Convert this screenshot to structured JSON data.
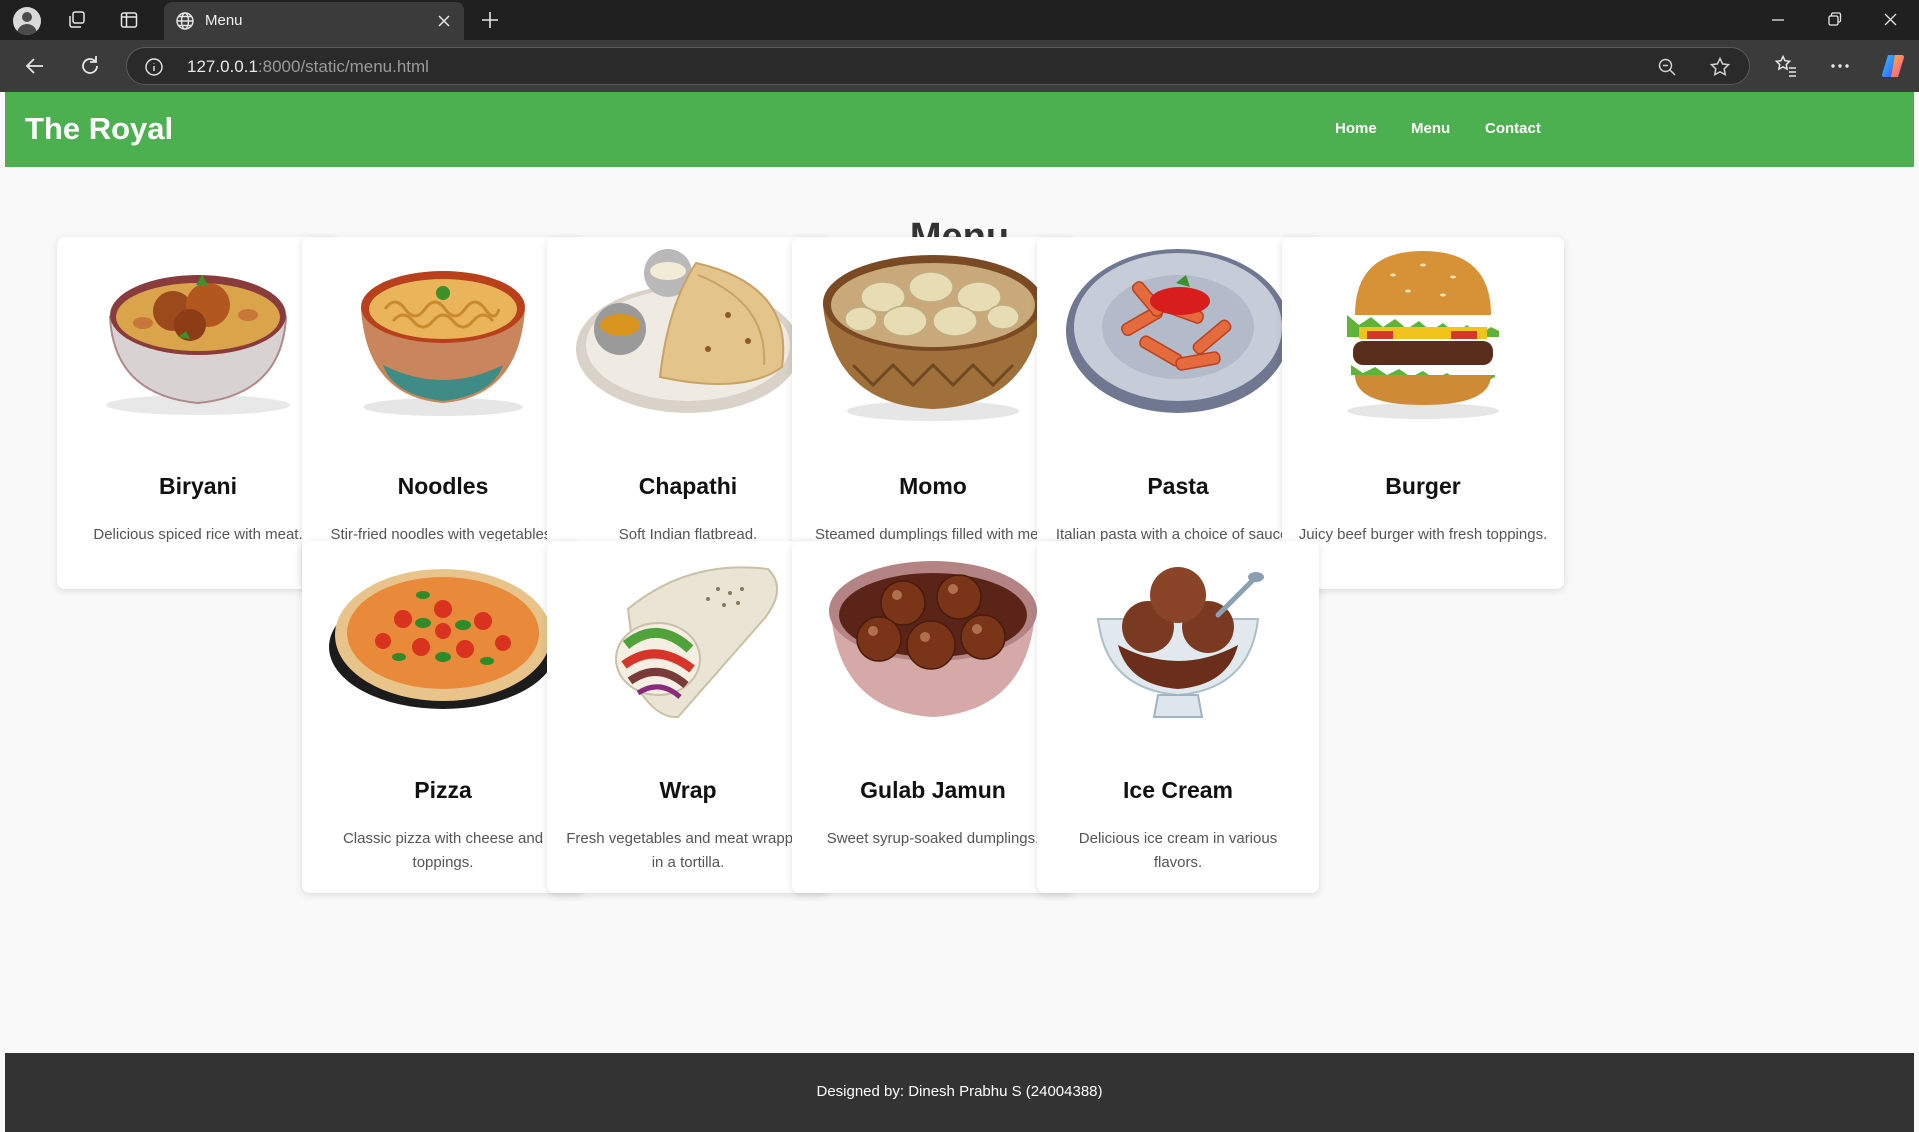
{
  "browser": {
    "tab_title": "Menu",
    "url_host": "127.0.0.1",
    "url_rest": ":8000/static/menu.html"
  },
  "site": {
    "brand": "The Royal",
    "nav": [
      "Home",
      "Menu",
      "Contact"
    ],
    "heading": "Menu",
    "footer": "Designed by: Dinesh Prabhu S (24004388)"
  },
  "menu_items": [
    {
      "name": "Biryani",
      "desc": "Delicious spiced rice with meat."
    },
    {
      "name": "Noodles",
      "desc": "Stir-fried noodles with vegetables."
    },
    {
      "name": "Chapathi",
      "desc": "Soft Indian flatbread."
    },
    {
      "name": "Momo",
      "desc": "Steamed dumplings filled with meat or vegetables."
    },
    {
      "name": "Pasta",
      "desc": "Italian pasta with a choice of sauces."
    },
    {
      "name": "Burger",
      "desc": "Juicy beef burger with fresh toppings."
    },
    {
      "name": "Pizza",
      "desc": "Classic pizza with cheese and toppings."
    },
    {
      "name": "Wrap",
      "desc": "Fresh vegetables and meat wrapped in a tortilla."
    },
    {
      "name": "Gulab Jamun",
      "desc": "Sweet syrup-soaked dumplings."
    },
    {
      "name": "Ice Cream",
      "desc": "Delicious ice cream in various flavors."
    }
  ],
  "colors": {
    "header": "#4caf50",
    "footer": "#333333",
    "page_bg": "#f9f9f9",
    "card_bg": "#ffffff"
  }
}
